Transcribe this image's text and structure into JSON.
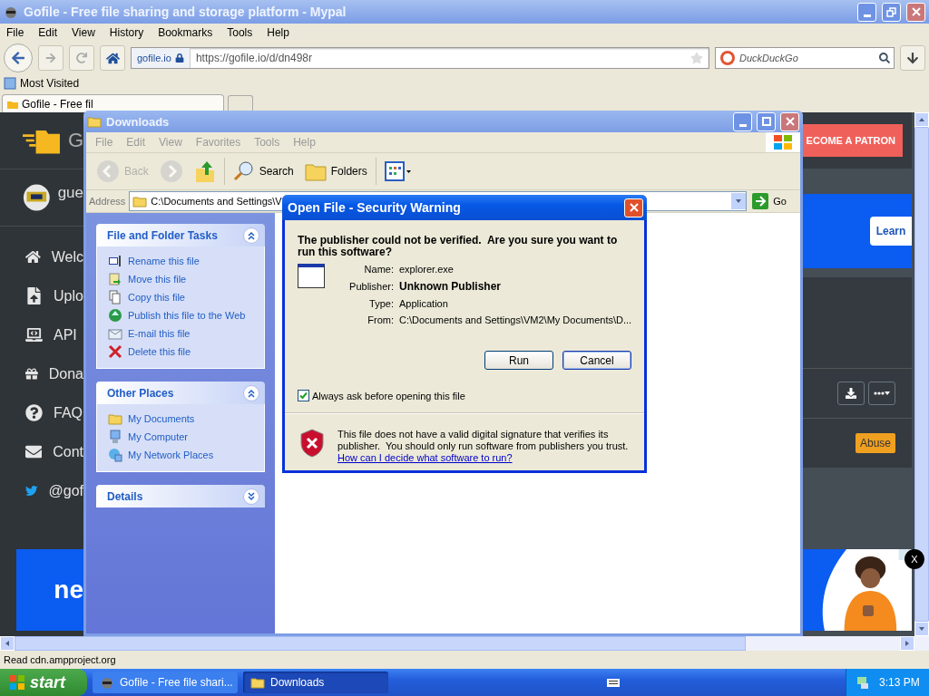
{
  "browser": {
    "title": "Gofile - Free file sharing and storage platform - Mypal",
    "menu": [
      "File",
      "Edit",
      "View",
      "History",
      "Bookmarks",
      "Tools",
      "Help"
    ],
    "identity": "gofile.io",
    "url": "https://gofile.io/d/dn498r",
    "search_placeholder": "DuckDuckGo",
    "bookmarks": [
      "Most Visited"
    ],
    "tabs": [
      {
        "label": "Gofile - Free fil",
        "selected": true
      }
    ],
    "status": "Read cdn.ampproject.org"
  },
  "page": {
    "logo_text": "G",
    "user": "gue",
    "nav": [
      {
        "label": "Welc"
      },
      {
        "label": "Uplo"
      },
      {
        "label": "API"
      },
      {
        "label": "Dona"
      },
      {
        "label": "FAQ"
      },
      {
        "label": "Cont"
      },
      {
        "label": "@gof"
      }
    ],
    "patron_button": "ECOME A PATRON",
    "learn_button": "Learn",
    "abuse_button": "Abuse",
    "ad_text": "ne",
    "ad_close": "X"
  },
  "explorer": {
    "title": "Downloads",
    "menu": [
      "File",
      "Edit",
      "View",
      "Favorites",
      "Tools",
      "Help"
    ],
    "toolbar": [
      {
        "label": "Back",
        "disabled": true
      },
      {
        "disabled": true
      },
      {
        "disabled": false
      },
      {
        "label": "Search",
        "disabled": false
      },
      {
        "label": "Folders",
        "disabled": false
      },
      {
        "disabled": false
      }
    ],
    "address_label": "Address",
    "address": "C:\\Documents and Settings\\V",
    "go": "Go",
    "panels": [
      {
        "title": "File and Folder Tasks",
        "expanded": true,
        "items": [
          {
            "label": "Rename this file"
          },
          {
            "label": "Move this file"
          },
          {
            "label": "Copy this file"
          },
          {
            "label": "Publish this file to the Web"
          },
          {
            "label": "E-mail this file"
          },
          {
            "label": "Delete this file"
          }
        ]
      },
      {
        "title": "Other Places",
        "expanded": true,
        "items": [
          {
            "label": "My Documents"
          },
          {
            "label": "My Computer"
          },
          {
            "label": "My Network Places"
          }
        ]
      },
      {
        "title": "Details",
        "expanded": false
      }
    ]
  },
  "dialog": {
    "title": "Open File - Security Warning",
    "question": "The publisher could not be verified.  Are you sure you want to run this software?",
    "fields": [
      {
        "label": "Name:",
        "value": "explorer.exe",
        "bold": false
      },
      {
        "label": "Publisher:",
        "value": "Unknown Publisher",
        "bold": true
      },
      {
        "label": "Type:",
        "value": "Application",
        "bold": false
      },
      {
        "label": "From:",
        "value": "C:\\Documents and Settings\\VM2\\My Documents\\D...",
        "bold": false
      }
    ],
    "buttons": [
      {
        "label": "Run",
        "selected": false
      },
      {
        "label": "Cancel",
        "selected": true
      }
    ],
    "always_ask": {
      "label": "Always ask before opening this file",
      "checked": true
    },
    "warning": "This file does not have a valid digital signature that verifies its publisher.  You should only run software from publishers you trust.",
    "link": "How can I decide what software to run?"
  },
  "taskbar": {
    "start": "start",
    "tasks": [
      {
        "label": "Gofile - Free file shari...",
        "selected": false
      },
      {
        "label": "Downloads",
        "selected": true
      }
    ],
    "clock": "3:13 PM"
  }
}
